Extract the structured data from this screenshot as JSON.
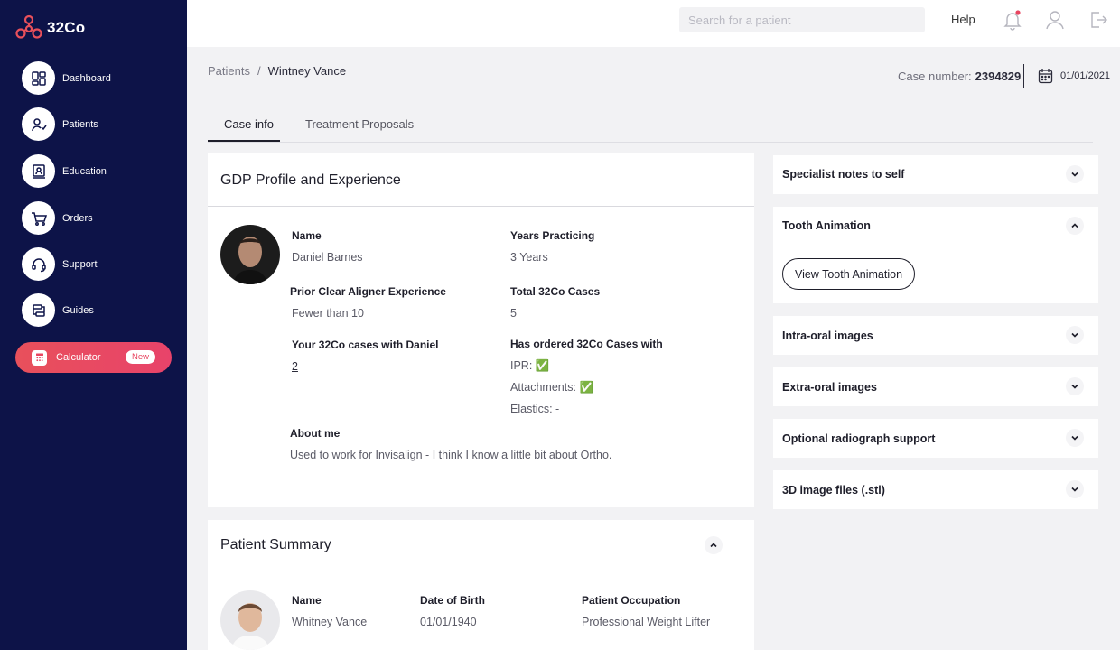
{
  "app": {
    "logo_text": "32Co"
  },
  "sidebar": {
    "items": [
      {
        "label": "Dashboard",
        "icon": "dashboard-icon"
      },
      {
        "label": "Patients",
        "icon": "patients-icon"
      },
      {
        "label": "Education",
        "icon": "education-icon"
      },
      {
        "label": "Orders",
        "icon": "cart-icon"
      },
      {
        "label": "Support",
        "icon": "headset-icon"
      },
      {
        "label": "Guides",
        "icon": "guides-icon"
      }
    ],
    "calculator": {
      "label": "Calculator",
      "badge": "New",
      "icon": "calculator-icon"
    }
  },
  "topbar": {
    "search_placeholder": "Search for a patient",
    "help_label": "Help",
    "icons": [
      "bell-icon",
      "user-icon",
      "logout-icon"
    ]
  },
  "breadcrumb": {
    "root": "Patients",
    "separator": "/",
    "current": "Wintney Vance"
  },
  "case": {
    "number_label": "Case number:",
    "number": "2394829",
    "date": "01/01/2021"
  },
  "tabs": [
    {
      "label": "Case info",
      "active": true
    },
    {
      "label": "Treatment Proposals",
      "active": false
    }
  ],
  "gdp_profile": {
    "title": "GDP Profile and Experience",
    "name_label": "Name",
    "name": "Daniel Barnes",
    "years_label": "Years Practicing",
    "years": "3 Years",
    "prior_label": "Prior Clear Aligner Experience",
    "prior": "Fewer than 10",
    "total_label": "Total 32Co Cases",
    "total": "5",
    "your_cases_label": "Your 32Co cases with Daniel",
    "your_cases": "2",
    "ordered_label": "Has ordered 32Co Cases with",
    "ordered": [
      {
        "label": "IPR:",
        "mark": "✅"
      },
      {
        "label": "Attachments:",
        "mark": "✅"
      },
      {
        "label": "Elastics:",
        "mark": "-"
      }
    ],
    "about_label": "About me",
    "about": "Used to work for Invisalign - I think I know a little bit about Ortho."
  },
  "patient_summary": {
    "title": "Patient Summary",
    "name_label": "Name",
    "name": "Whitney Vance",
    "dob_label": "Date of Birth",
    "dob": "01/01/1940",
    "occupation_label": "Patient Occupation",
    "occupation": "Professional Weight Lifter"
  },
  "right_panels": {
    "specialist_notes": "Specialist notes to self",
    "tooth_animation": "Tooth Animation",
    "view_tooth_button": "View Tooth Animation",
    "intra_oral": "Intra-oral images",
    "extra_oral": "Extra-oral images",
    "radiograph": "Optional radiograph support",
    "stl_files": "3D image files (.stl)"
  },
  "colors": {
    "sidebar_bg": "#0d1348",
    "accent_red": "#e84560",
    "notification_dot": "#e84560"
  }
}
